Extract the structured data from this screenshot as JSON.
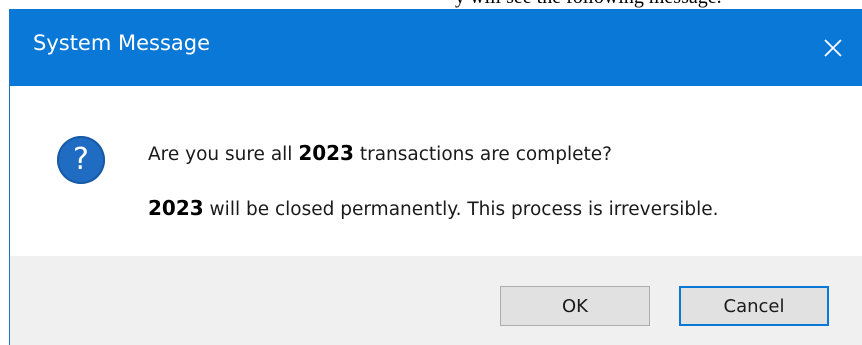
{
  "window": {
    "title": "System Message"
  },
  "message": {
    "line1_prefix": "Are you sure all ",
    "line1_year": "2023",
    "line1_suffix": " transactions are complete?",
    "line2_year": "2023",
    "line2_suffix": " will be closed permanently. This process is irreversible."
  },
  "buttons": {
    "ok_label": "OK",
    "cancel_label": "Cancel",
    "default": "cancel"
  },
  "icons": {
    "dialog": "question-icon",
    "close": "close-icon"
  },
  "colors": {
    "titlebar": "#0a78d7",
    "question_icon": "#1f6cc2",
    "footer": "#f0f0f0",
    "focused_button_border": "#0a78d7"
  }
}
